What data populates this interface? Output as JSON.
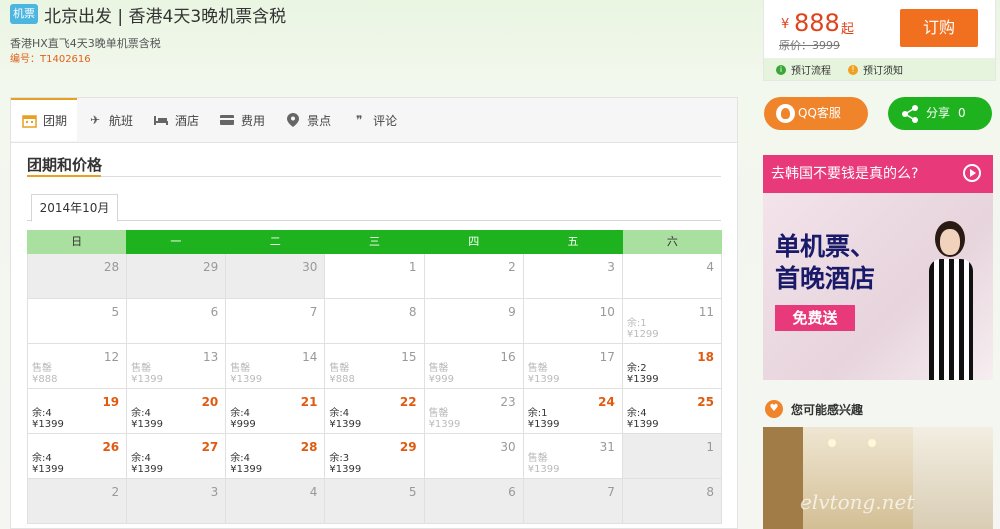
{
  "header": {
    "badge": "机票",
    "title": "北京出发 | 香港4天3晚机票含税",
    "subtitle": "香港HX直飞4天3晚单机票含税",
    "code_label": "编号：",
    "code_value": "T1402616"
  },
  "price_box": {
    "currency": "¥",
    "price": "888",
    "suffix": "起",
    "original": "原价：3999",
    "book_label": "订购",
    "flow_label": "预订流程",
    "notice_label": "预订须知"
  },
  "tabs": [
    {
      "label": "团期",
      "icon": "calendar-icon"
    },
    {
      "label": "航班",
      "icon": "plane-icon"
    },
    {
      "label": "酒店",
      "icon": "bed-icon"
    },
    {
      "label": "费用",
      "icon": "wallet-icon"
    },
    {
      "label": "景点",
      "icon": "location-pin-icon"
    },
    {
      "label": "评论",
      "icon": "comment-icon"
    }
  ],
  "section_title": "团期和价格",
  "month_tab": "2014年10月",
  "weekdays": [
    "日",
    "一",
    "二",
    "三",
    "四",
    "五",
    "六"
  ],
  "calendar": [
    [
      {
        "d": "28",
        "grey": true
      },
      {
        "d": "29",
        "grey": true
      },
      {
        "d": "30",
        "grey": true
      },
      {
        "d": "1"
      },
      {
        "d": "2"
      },
      {
        "d": "3"
      },
      {
        "d": "4"
      }
    ],
    [
      {
        "d": "5"
      },
      {
        "d": "6"
      },
      {
        "d": "7"
      },
      {
        "d": "8"
      },
      {
        "d": "9"
      },
      {
        "d": "10"
      },
      {
        "d": "11",
        "l1": "余:1",
        "l2": "¥1299",
        "off": true
      }
    ],
    [
      {
        "d": "12",
        "l1": "售罄",
        "l2": "¥888",
        "off": true
      },
      {
        "d": "13",
        "l1": "售罄",
        "l2": "¥1399",
        "off": true
      },
      {
        "d": "14",
        "l1": "售罄",
        "l2": "¥1399",
        "off": true
      },
      {
        "d": "15",
        "l1": "售罄",
        "l2": "¥888",
        "off": true
      },
      {
        "d": "16",
        "l1": "售罄",
        "l2": "¥999",
        "off": true
      },
      {
        "d": "17",
        "l1": "售罄",
        "l2": "¥1399",
        "off": true
      },
      {
        "d": "18",
        "l1": "余:2",
        "l2": "¥1399",
        "hot": true
      }
    ],
    [
      {
        "d": "19",
        "l1": "余:4",
        "l2": "¥1399",
        "hot": true
      },
      {
        "d": "20",
        "l1": "余:4",
        "l2": "¥1399",
        "hot": true
      },
      {
        "d": "21",
        "l1": "余:4",
        "l2": "¥999",
        "hot": true
      },
      {
        "d": "22",
        "l1": "余:4",
        "l2": "¥1399",
        "hot": true
      },
      {
        "d": "23",
        "l1": "售罄",
        "l2": "¥1399",
        "off": true
      },
      {
        "d": "24",
        "l1": "余:1",
        "l2": "¥1399",
        "hot": true
      },
      {
        "d": "25",
        "l1": "余:4",
        "l2": "¥1399",
        "hot": true
      }
    ],
    [
      {
        "d": "26",
        "l1": "余:4",
        "l2": "¥1399",
        "hot": true
      },
      {
        "d": "27",
        "l1": "余:4",
        "l2": "¥1399",
        "hot": true
      },
      {
        "d": "28",
        "l1": "余:4",
        "l2": "¥1399",
        "hot": true
      },
      {
        "d": "29",
        "l1": "余:3",
        "l2": "¥1399",
        "hot": true
      },
      {
        "d": "30"
      },
      {
        "d": "31",
        "l1": "售罄",
        "l2": "¥1399",
        "off": true
      },
      {
        "d": "1",
        "grey": true
      }
    ],
    [
      {
        "d": "2",
        "grey": true
      },
      {
        "d": "3",
        "grey": true
      },
      {
        "d": "4",
        "grey": true
      },
      {
        "d": "5",
        "grey": true
      },
      {
        "d": "6",
        "grey": true
      },
      {
        "d": "7",
        "grey": true
      },
      {
        "d": "8",
        "grey": true
      }
    ]
  ],
  "sidebar": {
    "qq_label": "QQ客服",
    "share_label": "分享",
    "share_count": "0",
    "ad_top": "去韩国不要钱是真的么?",
    "ad_line1": "单机票、",
    "ad_line2": "首晚酒店",
    "ad_free": "免费送",
    "interest_label": "您可能感兴趣",
    "watermark": "elvtong.net"
  },
  "colors": {
    "accent_green": "#1eb31e",
    "accent_orange": "#f07020",
    "price_red": "#e0431a",
    "hot_date": "#e05a10"
  }
}
